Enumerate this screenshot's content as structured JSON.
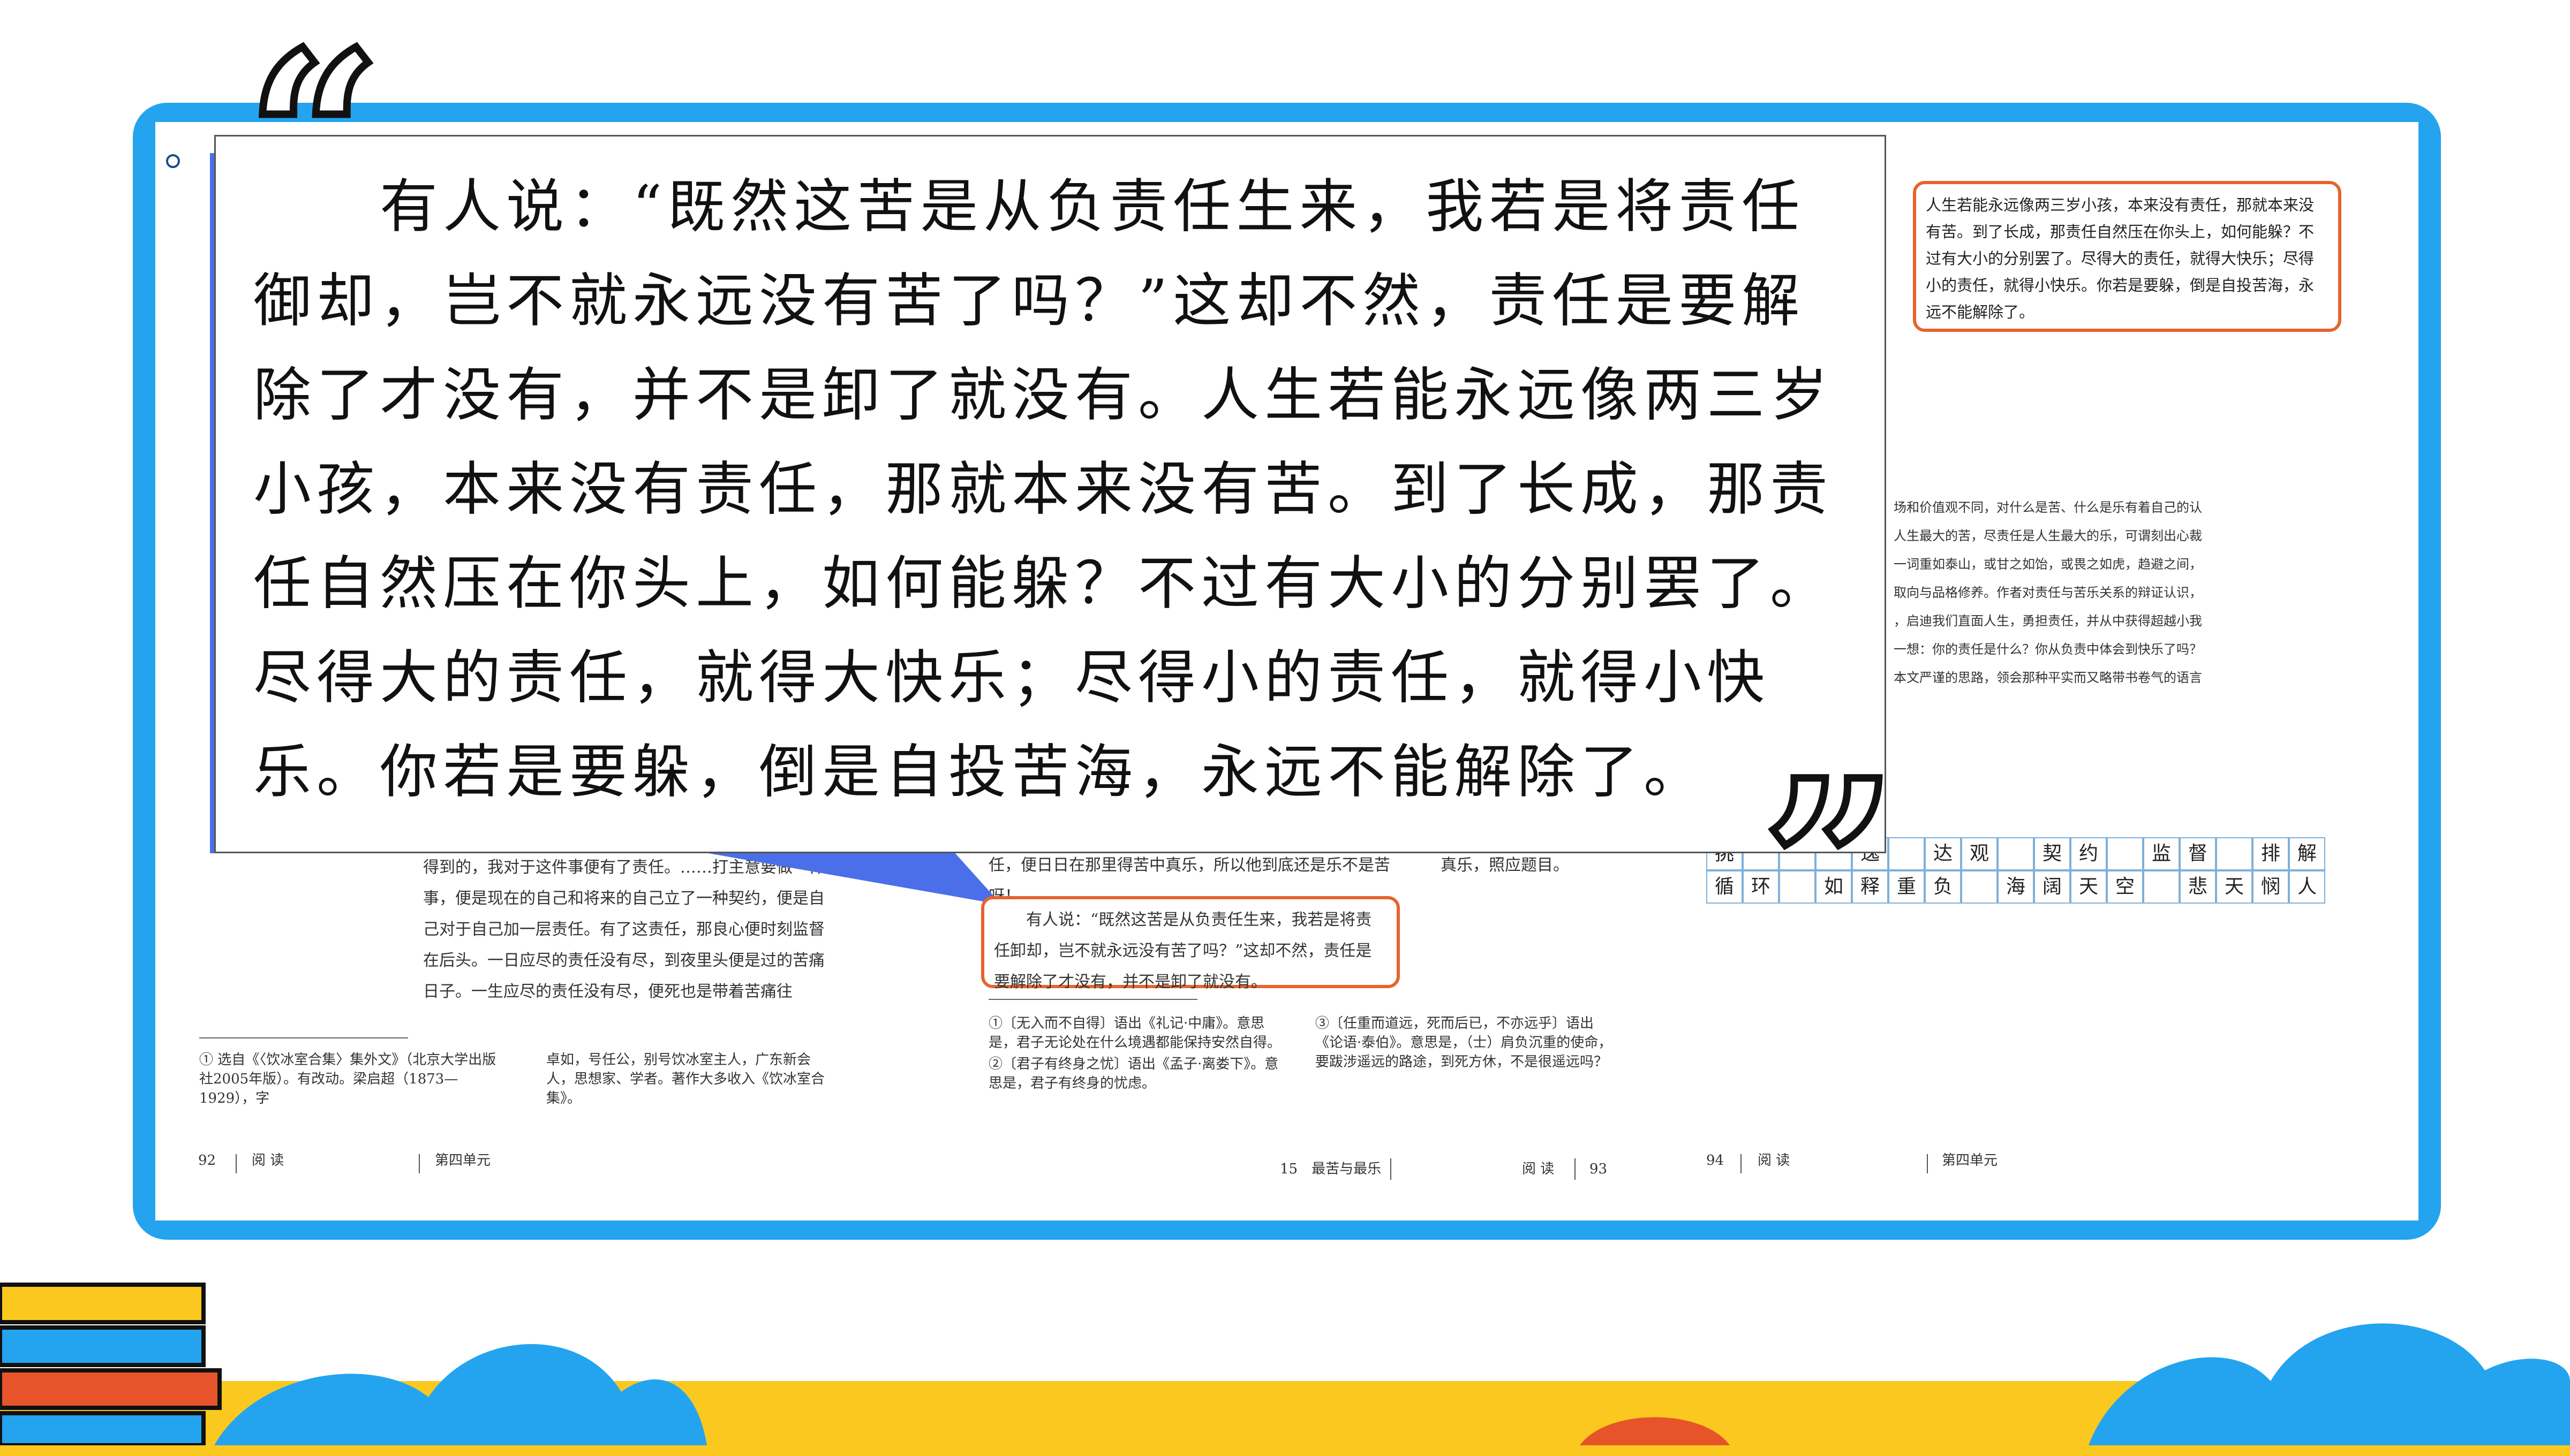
{
  "callout": {
    "text": "　　有人说：“既然这苦是从负责任生来，我若是将责任御却，岂不就永远没有苦了吗？”这却不然，责任是要解除了才没有，并不是卸了就没有。人生若能永远像两三岁小孩，本来没有责任，那就本来没有苦。到了长成，那责任自然压在你头上，如何能躲？不过有大小的分别罢了。尽得大的责任，就得大快乐；尽得小的责任，就得小快乐。你若是要躲，倒是自投苦海，永远不能解除了。"
  },
  "quote_marks": {
    "open": "“",
    "close": "”"
  },
  "right_box": {
    "text": "人生若能永远像两三岁小孩，本来没有责任，那就本来没有苦。到了长成，那责任自然压在你头上，如何能躲？不过有大小的分别罢了。尽得大的责任，就得大快乐；尽得小的责任，就得小快乐。你若是要躲，倒是自投苦海，永远不能解除了。"
  },
  "middle_box": {
    "text": "　　有人说：“既然这苦是从负责任生来，我若是将责任卸却，岂不就永远没有苦了吗？”这却不然，责任是要解除了才没有，并不是卸了就没有。"
  },
  "middle_text_above": "任，便日日在那里得苦中真乐，所以他到底还是乐不是苦呀！",
  "middle_text_right": "真乐，照应题目。",
  "left_page": {
    "body": "得到的，我对于这件事便有了责任。……打主意要做一件事，便是现在的自己和将来的自己立了一种契约，便是自己对于自己加一层责任。有了这责任，那良心便时刻监督在后头。一日应尽的责任没有尽，到夜里头便是过的苦痛日子。一生应尽的责任没有尽，便死也是带着苦痛往",
    "footnote_left": "① 选自《〈饮冰室合集〉集外文》（北京大学出版社2005年版）。有改动。梁启超（1873—1929），字",
    "footnote_right": "卓如，号任公，别号饮冰室主人，广东新会人，思想家、学者。著作大多收入《饮冰室合集》。",
    "page_num": "92",
    "section": "阅 读",
    "unit": "第四单元"
  },
  "middle_page": {
    "footnote_1": "①〔无入而不自得〕语出《礼记·中庸》。意思是，君子无论处在什么境遇都能保持安然自得。",
    "footnote_2": "②〔君子有终身之忧〕语出《孟子·离娄下》。意思是，君子有终身的忧虑。",
    "footnote_3": "③〔任重而道远，死而后已，不亦远乎〕语出《论语·泰伯》。意思是，（士）肩负沉重的使命，要跋涉遥远的路途，到死方休，不是很遥远吗？",
    "lesson": "15　最苦与最乐",
    "section": "阅 读",
    "page_num": "93"
  },
  "right_page": {
    "lines": [
      "场和价值观不同，对什么是苦、什么是乐有着自己的认",
      "人生最大的苦，尽责任是人生最大的乐，可谓刻出心裁",
      "一词重如泰山，或甘之如饴，或畏之如虎，趋避之间，",
      "取向与品格修养。作者对责任与苦乐关系的辩证认识，",
      "，启迪我们直面人生，勇担责任，并从中获得超越小我",
      "一想：你的责任是什么？你从负责中体会到快乐了吗？",
      "本文严谨的思路，领会那种平实而又略带书卷气的语言"
    ],
    "grid_row1": [
      "挑",
      "",
      "",
      "",
      "逸",
      "",
      "达",
      "观",
      "",
      "契",
      "约",
      "",
      "监",
      "督",
      "",
      "排",
      "解"
    ],
    "grid_row2": [
      "循",
      "环",
      "",
      "如",
      "释",
      "重",
      "负",
      "",
      "海",
      "阔",
      "天",
      "空",
      "",
      "悲",
      "天",
      "悯",
      "人"
    ],
    "page_num": "94",
    "section": "阅 读",
    "unit": "第四单元"
  },
  "colors": {
    "frame": "#24a4ef",
    "highlight": "#e6642c",
    "callout_bar": "#4a6fe8",
    "deco_yellow": "#fbc81f",
    "deco_blue": "#24a4ef",
    "deco_red": "#e8542a"
  }
}
